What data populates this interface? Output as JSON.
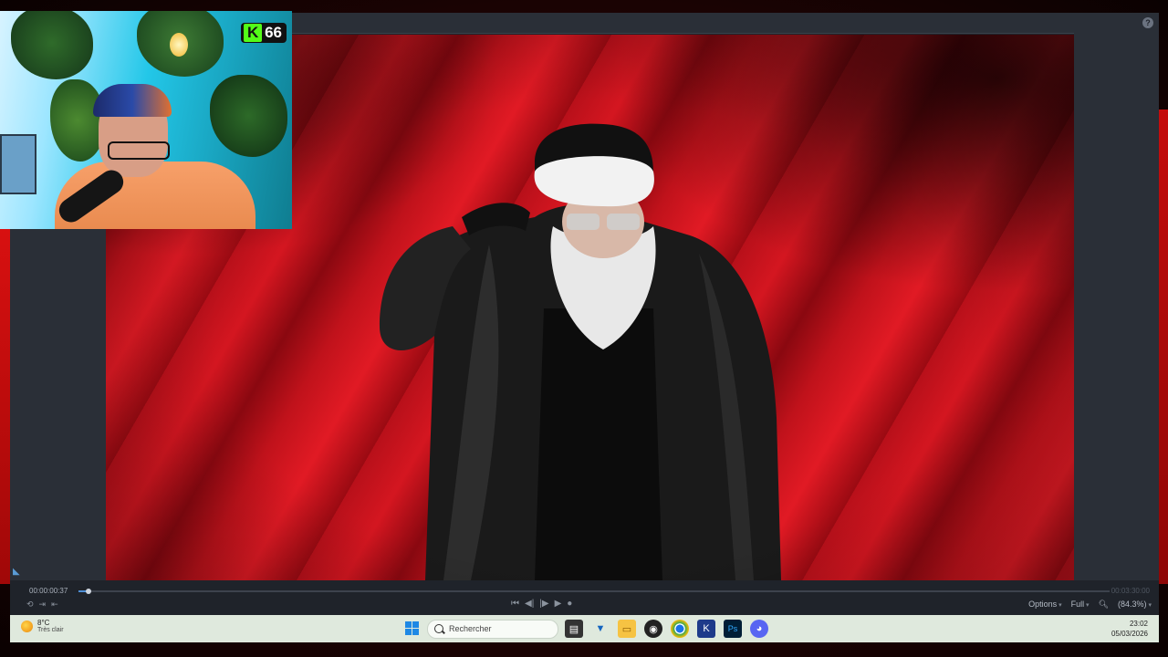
{
  "player": {
    "current_time": "00:00:00:37",
    "total_time": "00:03:30:00",
    "progress": 0.01,
    "options_label": "Options",
    "quality_label": "Full",
    "zoom_label": "(84.3%)",
    "help_icon": "question-icon"
  },
  "taskbar": {
    "weather_temp": "8°C",
    "weather_desc": "Très clair",
    "search_placeholder": "Rechercher",
    "time": "23:02",
    "date": "05/03/2026",
    "apps": [
      "explorer-icon",
      "vlc-icon",
      "folder-icon",
      "obs-icon",
      "chrome-icon",
      "k-icon",
      "photoshop-icon",
      "discord-icon"
    ]
  },
  "overlay": {
    "kick_count": "66",
    "kick_color": "#53fc18"
  },
  "colors": {
    "accent": "#4e8fd6",
    "taskbar": "#dfe9dd",
    "app_bg": "#1f232a"
  }
}
